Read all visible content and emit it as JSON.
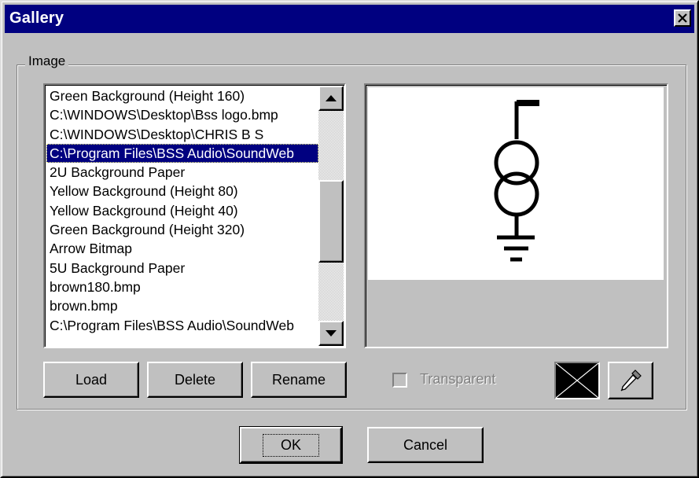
{
  "window": {
    "title": "Gallery",
    "close_glyph": "✕"
  },
  "image_group": {
    "label": "Image",
    "list_items": [
      "Green Background (Height 160)",
      "C:\\WINDOWS\\Desktop\\Bss logo.bmp",
      "C:\\WINDOWS\\Desktop\\CHRIS B S",
      "C:\\Program Files\\BSS Audio\\SoundWeb",
      "2U Background Paper",
      "Yellow Background (Height 80)",
      "Yellow Background (Height 40)",
      "Green Background (Height 320)",
      "Arrow Bitmap",
      "5U Background Paper",
      "brown180.bmp",
      "brown.bmp",
      "C:\\Program Files\\BSS Audio\\SoundWeb"
    ],
    "selected_index": 3,
    "buttons": {
      "load": "Load",
      "delete": "Delete",
      "rename": "Rename"
    },
    "transparent_label": "Transparent",
    "transparent_checked": false,
    "preview_icon": "transformer-symbol-icon",
    "swatch_icon": "empty-color-swatch-icon",
    "picker_icon": "eyedropper-icon"
  },
  "dialog_buttons": {
    "ok": "OK",
    "cancel": "Cancel"
  },
  "colors": {
    "titlebar": "#000080",
    "face": "#c0c0c0",
    "selection": "#000080"
  }
}
